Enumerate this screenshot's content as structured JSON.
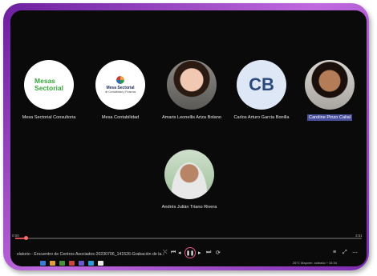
{
  "participants": [
    {
      "name": "Mesa Sectorial Consultoria",
      "logo_text": "Mesas\nSectorial"
    },
    {
      "name": "Mesa Contabilidad",
      "logo_text": "Mesa Sectorial",
      "logo_sub": "de Contabilidad y Finanzas"
    },
    {
      "name": "Amaris Leonellis Ariza Bolano"
    },
    {
      "name": "Carlos Arturo Garcia Bonilla",
      "initials": "CB"
    },
    {
      "name": "Caroline Pinzo Calial"
    },
    {
      "name": "Andrés Julián Triano Rivera"
    }
  ],
  "player": {
    "progress_fraction": 0.03,
    "time_left": "0:00",
    "time_right": "3:51",
    "title": "xlatorio - Encuentro de Centros Asociados-20230706_141526-Grabación de la...",
    "tray_text": "26°C  Mayorm. soleado  ^  10:34"
  },
  "colors": {
    "accent": "#e05a8a",
    "frame": "#a44fd0",
    "highlight": "#4a4f9e"
  }
}
